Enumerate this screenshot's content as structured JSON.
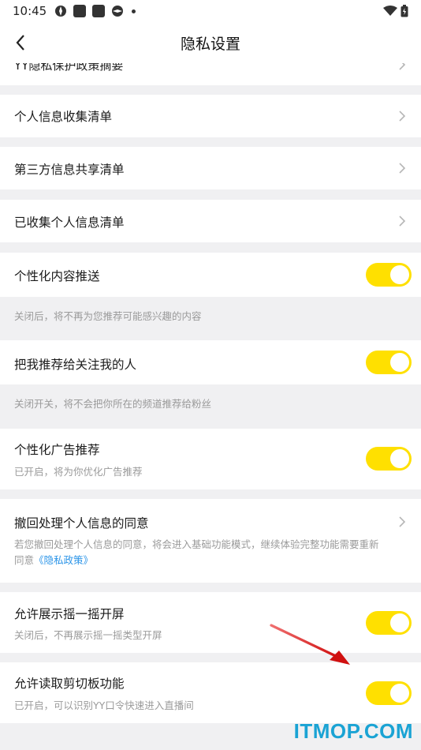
{
  "status_bar": {
    "time": "10:45"
  },
  "header": {
    "title": "隐私设置"
  },
  "rows": {
    "top_clipped": {
      "label": "YY隐私保护政策摘要"
    },
    "personal_info_list": {
      "label": "个人信息收集清单"
    },
    "third_party_share": {
      "label": "第三方信息共享清单"
    },
    "collected_info": {
      "label": "已收集个人信息清单"
    },
    "personalized_content": {
      "label": "个性化内容推送",
      "desc": "关闭后，将不再为您推荐可能感兴趣的内容",
      "enabled": true
    },
    "recommend_to_followers": {
      "label": "把我推荐给关注我的人",
      "desc": "关闭开关，将不会把你所在的频道推荐给粉丝",
      "enabled": true
    },
    "personalized_ads": {
      "label": "个性化广告推荐",
      "desc": "已开启，将为你优化广告推荐",
      "enabled": true
    },
    "withdraw_consent": {
      "label": "撤回处理个人信息的同意",
      "desc_line1": "若您撤回处理个人信息的同意，将会进入基础功能模式，继续体验完整功能需要重新",
      "desc_line2_prefix": "同意",
      "desc_link": "《隐私政策》"
    },
    "shake_splash": {
      "label": "允许展示摇一摇开屏",
      "desc": "关闭后，不再展示摇一摇类型开屏",
      "enabled": true
    },
    "clipboard": {
      "label": "允许读取剪切板功能",
      "desc": "已开启，可以识别YY口令快速进入直播间",
      "enabled": true
    }
  },
  "watermark": {
    "text": "ITMOP.COM"
  },
  "colors": {
    "toggle_on": "#ffe000",
    "link": "#2c95e8",
    "arrow": "#e02020",
    "watermark": "#1aa3d4"
  }
}
